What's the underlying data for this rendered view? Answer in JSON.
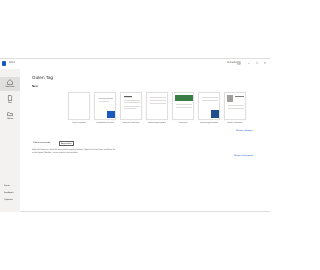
{
  "titlebar": {
    "app_title": "Word",
    "account": "Anmelden"
  },
  "sidebar": {
    "items": [
      {
        "label": "Startseite",
        "active": true
      },
      {
        "label": "Neu",
        "active": false
      },
      {
        "label": "Öffnen",
        "active": false
      }
    ],
    "bottom": [
      "Konto",
      "Feedback",
      "Optionen"
    ]
  },
  "main": {
    "greeting": "Guten Tag",
    "new_section": "Neu",
    "templates": [
      {
        "label": "Leeres Dokument"
      },
      {
        "label": "Willkommen bei Word"
      },
      {
        "label": "Einfacher Lebenslauf"
      },
      {
        "label": "Bewerbungsschreiben"
      },
      {
        "label": "Lebenslauf"
      },
      {
        "label": "Bewerbungsschreiben"
      },
      {
        "label": "Modern Lebenslauf"
      }
    ],
    "more_templates": "Weitere Vorlagen →",
    "tabs": [
      "Zuletzt verwendet",
      "Angeheftet"
    ],
    "info_line1": "Heften Sie Dateien an, auf die Sie später einfach zugreifen möchten. Zeigen Sie auf eine Datei, und klicken Sie",
    "info_line2": "auf das Symbol \"Anheften\", um sie an diese Liste anzuheften.",
    "more_docs": "Weitere Dokumente →"
  },
  "colors": {
    "accent": "#185abd",
    "sidebar_bg": "#f3f2f1",
    "text": "#323130"
  }
}
